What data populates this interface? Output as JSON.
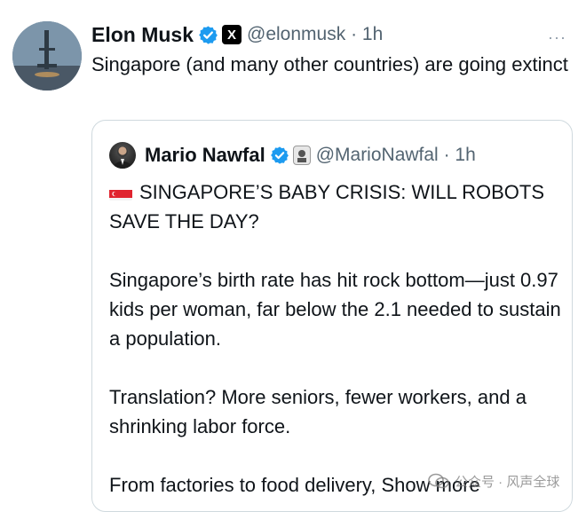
{
  "main_tweet": {
    "author_name": "Elon Musk",
    "affiliate_label": "X",
    "handle": "@elonmusk",
    "separator": "·",
    "time": "1h",
    "more_label": "···",
    "text": "Singapore (and many other countries) are going extinct"
  },
  "quoted_tweet": {
    "author_name": "Mario Nawfal",
    "handle": "@MarioNawfal",
    "separator": "·",
    "time": "1h",
    "headline": "SINGAPORE’S BABY CRISIS: WILL ROBOTS SAVE THE DAY?",
    "para1": "Singapore’s birth rate has hit rock bottom—just 0.97 kids per woman, far below the 2.1 needed to sustain a population.",
    "para2": "Translation? More seniors, fewer workers, and a shrinking labor force.",
    "para3": "From factories to food delivery, ",
    "show_more": "Show more"
  },
  "watermark": {
    "text": "公众号 · 风声全球"
  },
  "colors": {
    "verified_blue": "#1d9bf0",
    "secondary_text": "#536471",
    "border": "#cfd9de"
  }
}
